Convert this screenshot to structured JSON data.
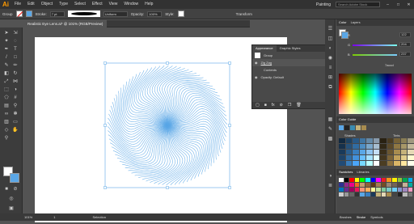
{
  "app": {
    "logo": "Ai",
    "workspace": "Painting",
    "search_placeholder": "Search Adobe Stock"
  },
  "menu": [
    "File",
    "Edit",
    "Object",
    "Type",
    "Select",
    "Effect",
    "View",
    "Window",
    "Help"
  ],
  "control": {
    "group_label": "Group",
    "stroke_label": "Stroke:",
    "stroke_weight": "7 pt",
    "uniform": "Uniform",
    "opacity_label": "Opacity:",
    "opacity_value": "100%",
    "style_label": "Style:",
    "transform_label": "Transform"
  },
  "document": {
    "tab": "Realistic Eye Lens.ai* @ 101% (RGB/Preview)"
  },
  "appearance": {
    "tabs": [
      "Appearance",
      "Graphic Styles"
    ],
    "rows": [
      "Group",
      "Zig Zag",
      "Contents",
      "Opacity:  Default"
    ],
    "fx": "fx"
  },
  "color_panel": {
    "tabs": [
      "Color",
      "Layers"
    ],
    "r": "122",
    "g": "204",
    "b": "237",
    "labels": [
      "R",
      "G",
      "B"
    ],
    "hex": "7accd"
  },
  "color_guide": {
    "title": "Color Guide",
    "shades": "Shades",
    "tints": "Tints"
  },
  "swatches": {
    "tabs": [
      "Swatches",
      "Libraries"
    ]
  },
  "bottom_panels": [
    "Brushes",
    "Stroke",
    "Symbols"
  ],
  "status": {
    "zoom": "101%",
    "page": "1",
    "tool": "Selection"
  },
  "colors": {
    "accent": "#5ba7e6",
    "bg": "#535353"
  }
}
